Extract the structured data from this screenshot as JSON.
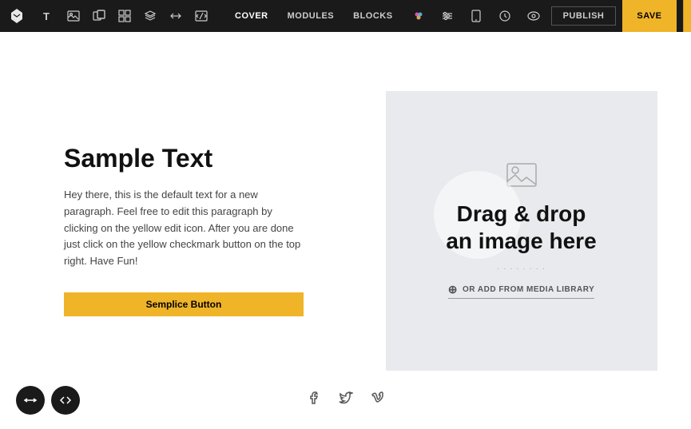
{
  "topbar": {
    "nav_items": [
      {
        "id": "cover",
        "label": "COVER",
        "active": true
      },
      {
        "id": "modules",
        "label": "MODULES",
        "active": false
      },
      {
        "id": "blocks",
        "label": "BLOCKS",
        "active": false
      }
    ],
    "publish_label": "PUBLISH",
    "save_label": "SAVE"
  },
  "left_panel": {
    "title": "Sample Text",
    "body": "Hey there, this is the default text for a new paragraph. Feel free to edit this paragraph by clicking on the yellow edit icon. After you are done just click on the yellow checkmark button on the top right. Have Fun!",
    "button_label": "Semplice Button"
  },
  "right_panel": {
    "drag_drop_line1": "Drag & drop",
    "drag_drop_line2": "an image here",
    "or_label": "OR ADD FROM MEDIA LIBRARY"
  },
  "social": {
    "icons": [
      "f",
      "t",
      "v"
    ]
  }
}
